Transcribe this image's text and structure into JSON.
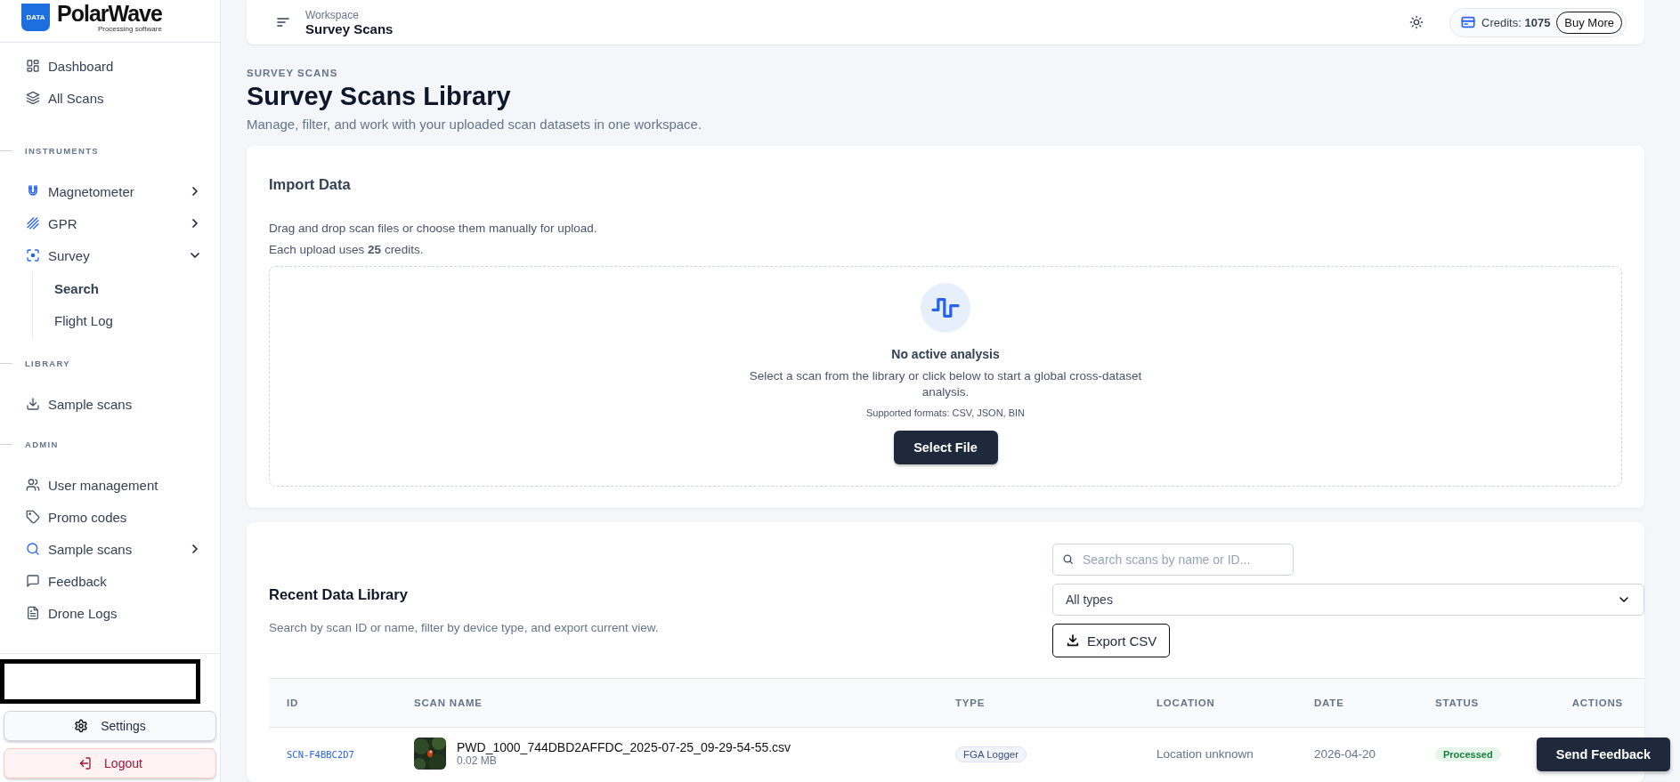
{
  "brand": {
    "badge": "DATA",
    "name": "PolarWave",
    "tagline": "Processing software"
  },
  "sidebar": {
    "sections": [
      {
        "items": [
          {
            "label": "Dashboard"
          },
          {
            "label": "All Scans"
          }
        ]
      },
      {
        "heading": "INSTRUMENTS",
        "items": [
          {
            "label": "Magnetometer",
            "expanded": false
          },
          {
            "label": "GPR",
            "expanded": false
          },
          {
            "label": "Survey",
            "expanded": true,
            "children": [
              {
                "label": "Search",
                "selected": true
              },
              {
                "label": "Flight Log",
                "selected": false
              }
            ]
          }
        ]
      },
      {
        "heading": "LIBRARY",
        "items": [
          {
            "label": "Sample scans"
          }
        ]
      },
      {
        "heading": "ADMIN",
        "items": [
          {
            "label": "User management"
          },
          {
            "label": "Promo codes"
          },
          {
            "label": "Sample scans",
            "expanded": false
          },
          {
            "label": "Feedback"
          },
          {
            "label": "Drone Logs"
          }
        ]
      }
    ],
    "settings": "Settings",
    "logout": "Logout"
  },
  "header": {
    "caption": "Workspace",
    "title": "Survey Scans",
    "credits_label": "Credits:",
    "credits": "1075",
    "buy": "Buy More"
  },
  "page": {
    "eyebrow": "SURVEY SCANS",
    "title": "Survey Scans Library",
    "subtitle": "Manage, filter, and work with your uploaded scan datasets in one workspace."
  },
  "import": {
    "title": "Import Data",
    "line1": "Drag and drop scan files or choose them manually for upload.",
    "line2": "Each upload uses **25** credits.",
    "empty_title": "No active analysis",
    "empty_text": "Select a scan from the library or click below to start a global cross-dataset analysis.",
    "formats": "Supported formats: CSV, JSON, BIN",
    "button": "Select File"
  },
  "library": {
    "title": "Recent Data Library",
    "subtitle": "Search by scan ID or name, filter by device type, and export current view.",
    "search": {
      "placeholder": "Search scans by name or ID..."
    },
    "filter": "All types",
    "export": "Export CSV",
    "columns": [
      "ID",
      "SCAN NAME",
      "TYPE",
      "LOCATION",
      "DATE",
      "STATUS",
      "ACTIONS"
    ],
    "rows": [
      {
        "id": "SCN-F4BBC2D7",
        "name": "PWD_1000_744DBD2AFFDC_2025-07-25_09-29-54-55.csv",
        "size": "0.02 MB",
        "type": "FGA Logger",
        "location": "Location unknown",
        "date": "2026-04-20",
        "status": "Processed"
      }
    ]
  },
  "feedback_button": "Send Feedback"
}
